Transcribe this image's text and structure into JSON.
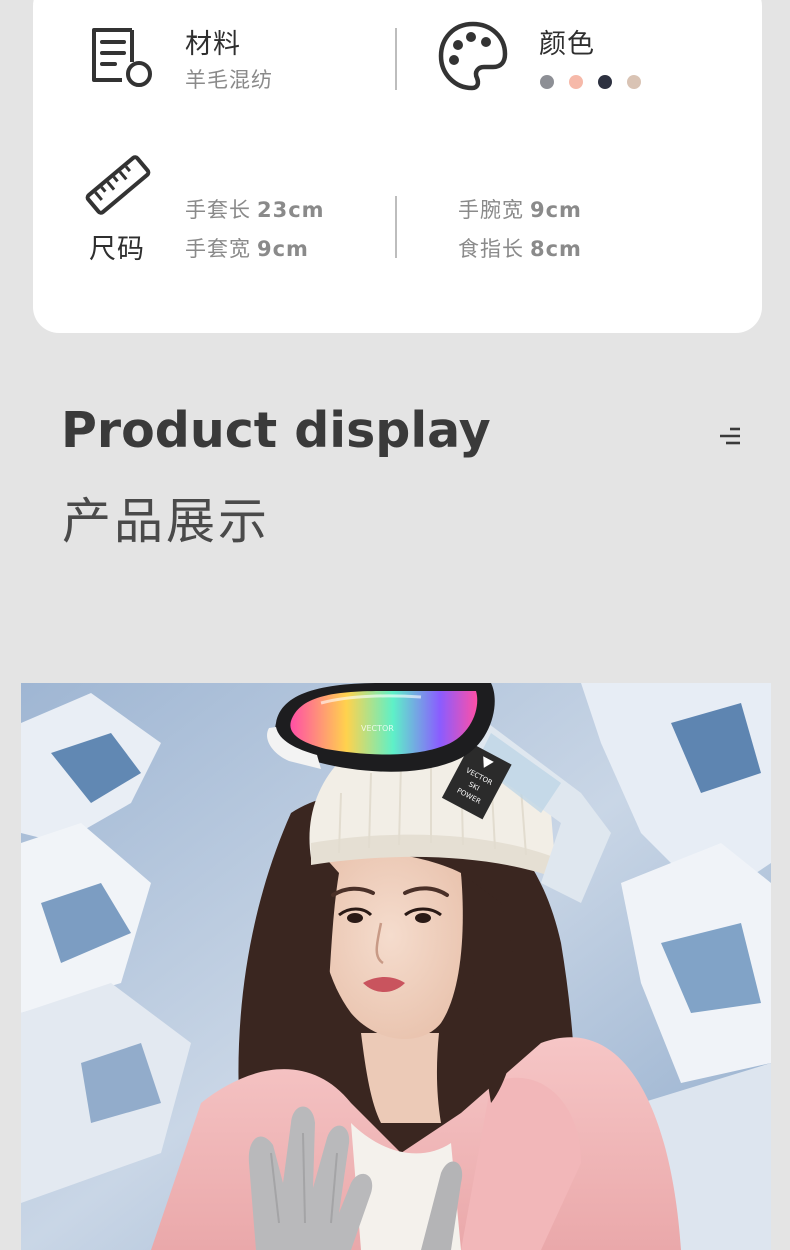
{
  "specs": {
    "material": {
      "title": "材料",
      "value": "羊毛混纺",
      "icon": "document-pencil-icon"
    },
    "color": {
      "title": "颜色",
      "icon": "palette-icon",
      "swatches": [
        "#8d8f95",
        "#f6b9a9",
        "#2d3140",
        "#d9c3b4"
      ]
    },
    "size": {
      "title": "尺码",
      "icon": "ruler-icon",
      "glove_length_label": "手套长",
      "glove_length_value": "23cm",
      "glove_width_label": "手套宽",
      "glove_width_value": "9cm",
      "wrist_width_label": "手腕宽",
      "wrist_width_value": "9cm",
      "finger_length_label": "食指长",
      "finger_length_value": "8cm"
    }
  },
  "section": {
    "title_en": "Product display",
    "title_zh": "产品展示",
    "menu_icon": "menu-lines-icon"
  },
  "photo": {
    "goggle_brand": "VECTOR",
    "goggle_badge_line1": "VECTOR",
    "goggle_badge_line2": "SKI",
    "goggle_badge_line3": "POWER"
  }
}
